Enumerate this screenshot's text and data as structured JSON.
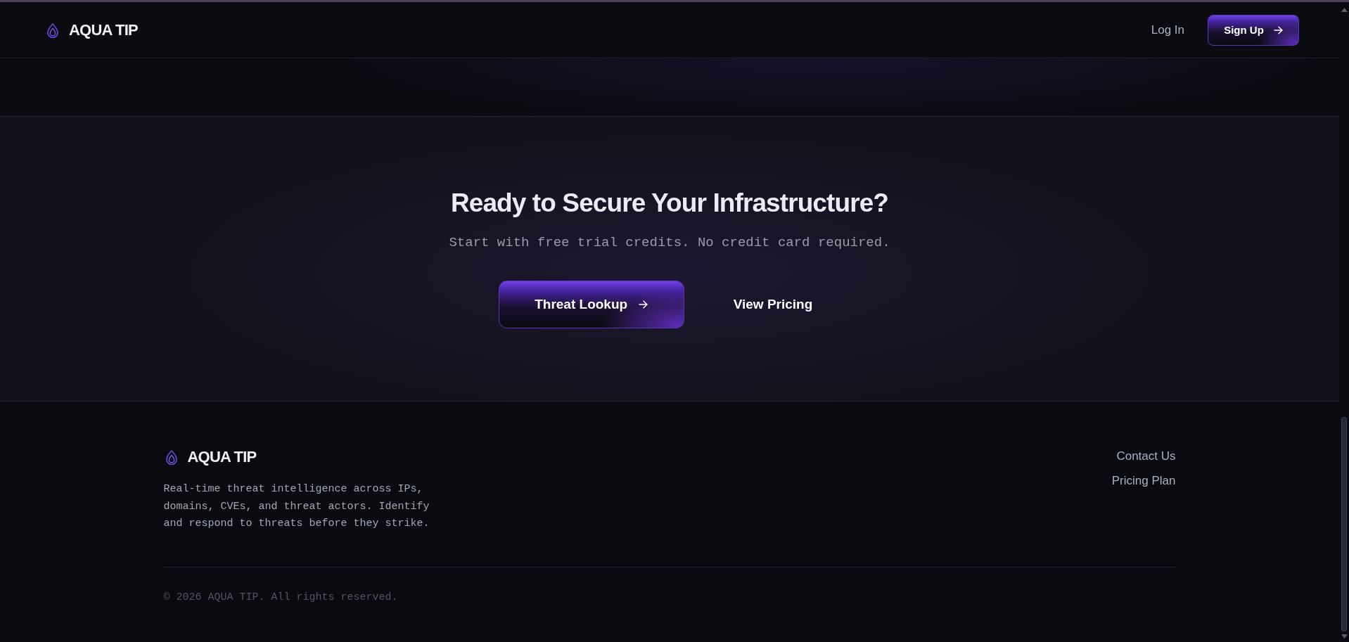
{
  "navbar": {
    "brand": "AQUA TIP",
    "links": [
      {
        "label": "Log In",
        "kind": "link"
      },
      {
        "label": "Sign Up",
        "kind": "primary"
      }
    ]
  },
  "cta": {
    "title": "Ready to Secure Your Infrastructure?",
    "subtitle": "Start with free trial credits. No credit card required.",
    "buttons": [
      {
        "label": "Threat Lookup",
        "kind": "primary"
      },
      {
        "label": "View Pricing",
        "kind": "link"
      }
    ]
  },
  "footer": {
    "brand": "AQUA TIP",
    "description": "Real-time threat intelligence across IPs, domains, CVEs, and threat actors. Identify and respond to threats before they strike.",
    "links": [
      "Contact Us",
      "Pricing Plan"
    ],
    "copyright": "© 2026 AQUA TIP. All rights reserved."
  }
}
